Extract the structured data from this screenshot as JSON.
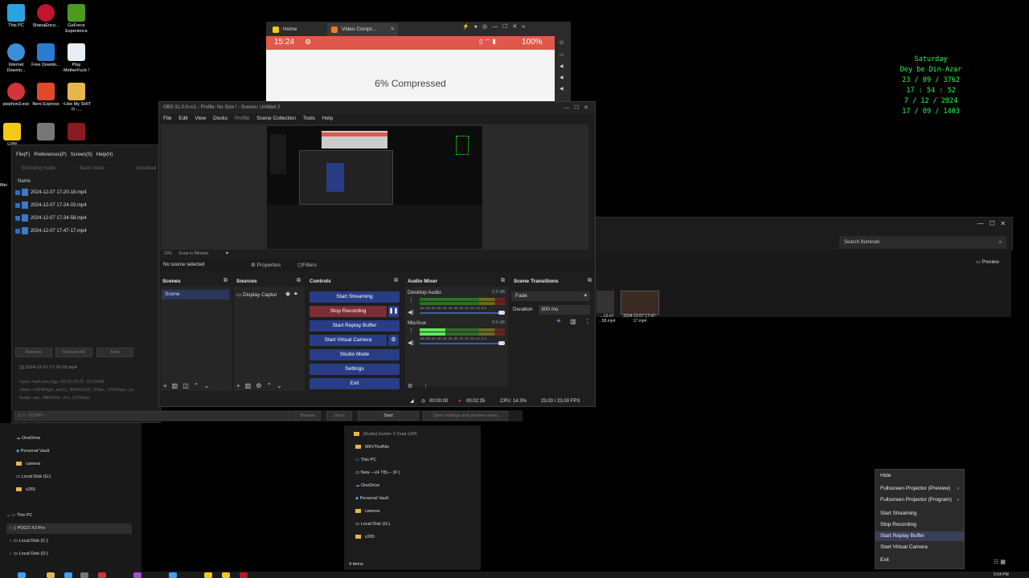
{
  "desktop": {
    "icons": [
      {
        "label": "This PC"
      },
      {
        "label": "ShanaEnco..."
      },
      {
        "label": "GeForce Experience"
      },
      {
        "label": "Internet Downlo..."
      },
      {
        "label": "Free Downlo..."
      },
      {
        "label": "Play MotherFuck !"
      },
      {
        "label": "psiphon3.exe"
      },
      {
        "label": "Nero Express"
      },
      {
        "label": "~Like My SHIT !!! -..."
      },
      {
        "label": "LDM"
      },
      {
        "label": "Mei"
      }
    ],
    "clock": {
      "day": "Saturday",
      "calendar": "Dey be Din-Azar",
      "date1": "23 / 09 / 3762",
      "time": "17 : 54 : 52",
      "date2": "7 / 12 / 2024",
      "date3": "17 / 09 / 1403"
    }
  },
  "scrcpy": {
    "tabs": [
      {
        "label": "Home"
      },
      {
        "label": "Video Compr..."
      }
    ],
    "status_time": "15:24",
    "battery": "100%",
    "compressed_text": "6% Compressed"
  },
  "left_app": {
    "menu": [
      "File(F)",
      "Preferences(P)",
      "Screen(S)",
      "Help(H)"
    ],
    "modes": [
      "Encoding mode:",
      "Basic mode",
      "Individual"
    ],
    "column_name": "Name",
    "files": [
      "2024-12-07 17-20-18.mp4",
      "2024-12-07 17-24-03.mp4",
      "2024-12-07 17-34-58.mp4",
      "2024-12-07 17-47-17.mp4"
    ],
    "buttons": {
      "remove": "Remove",
      "remove_all": "Remove All",
      "item": "Item"
    },
    "info": {
      "title": "[1] 2024-12-07 17-20-18.mp4",
      "input": "Input: mp4,mov,3gp, 00:01:29.22, 15.51MB",
      "video": "Video: h264(High, avc1), 3840x2160, 23fps, 1311Kbps, yu...",
      "audio": "Audio: aac, 48000Hz, 2ch, 137Kbps"
    },
    "output_path": "C:\\~ TODAY ~",
    "bottom_buttons": {
      "browse": "Browse",
      "open": "Open",
      "start": "Start",
      "open_settings": "Open settings and preview menu"
    }
  },
  "explorer_left": {
    "items": [
      "OneDrive",
      "Personal Vault",
      "camera",
      "Local Disk (G:)",
      "x265",
      "This PC",
      "POCO X3 Pro",
      "Local Disk (C:)",
      "Local Disk (D:)"
    ]
  },
  "explorer_right": {
    "search_placeholder": "Search illuminati",
    "preview_label": "Preview",
    "thumbnails": [
      {
        "label": "...12-07 ...58.mp4"
      },
      {
        "label": "2024-12-07 17-47-17.mp4"
      }
    ],
    "nav_items": [
      "[Audio] Hunter X Dual x265",
      "MKVToolNix",
      "This PC",
      "New ---(4 TB)--- (F:)",
      "OneDrive",
      "Personal Vault",
      "camera",
      "Local Disk (G:)",
      "x265"
    ],
    "status": "4 items"
  },
  "obs": {
    "title": "OBS 31.0.0-rc1 - Profile: No Size ! - Scenes: Untitled 2",
    "menu": [
      "File",
      "Edit",
      "View",
      "Docks",
      "Profile",
      "Scene Collection",
      "Tools",
      "Help"
    ],
    "zoom": "20%",
    "scale_mode": "Scale to Window",
    "no_source": "No source selected",
    "properties_btn": "Properties",
    "filters_btn": "Filters",
    "docks": {
      "scenes": "Scenes",
      "sources": "Sources",
      "controls": "Controls",
      "audio_mixer": "Audio Mixer",
      "scene_transitions": "Scene Transitions"
    },
    "scene_item": "Scene",
    "source_item": "Display Captur",
    "controls": {
      "start_streaming": "Start Streaming",
      "stop_recording": "Stop Recording",
      "start_replay": "Start Replay Buffer",
      "start_virtual_cam": "Start Virtual Camera",
      "studio_mode": "Studio Mode",
      "settings": "Settings",
      "exit": "Exit"
    },
    "audio": {
      "desktop_label": "Desktop Audio",
      "desktop_db": "0.0 dB",
      "mic_label": "Mic/Aux",
      "mic_db": "0.0 dB",
      "scale": "-60 -55 -50 -45 -40 -35 -30 -25 -20 -15 -10 -5 0"
    },
    "transitions": {
      "type": "Fade",
      "duration_label": "Duration",
      "duration_value": "300 ms"
    },
    "status": {
      "stream_time": "00:00:00",
      "rec_time": "00:02:35",
      "cpu": "CPU: 14.3%",
      "fps": "23.00 / 23.00 FPS"
    },
    "colors": {
      "button_blue": "#283d86",
      "button_red": "#7c2d36"
    }
  },
  "context_menu": {
    "items": [
      {
        "label": "Hide",
        "submenu": false
      },
      {
        "label": "Fullscreen Projector (Preview)",
        "submenu": true
      },
      {
        "label": "Fullscreen Projector (Program)",
        "submenu": true
      },
      {
        "label": "Start Streaming",
        "submenu": false
      },
      {
        "label": "Stop Recording",
        "submenu": false
      },
      {
        "label": "Start Replay Buffer",
        "submenu": false
      },
      {
        "label": "Start Virtual Camera",
        "submenu": false
      },
      {
        "label": "Exit",
        "submenu": false
      }
    ]
  },
  "taskbar": {
    "clock": "5:54 PM"
  }
}
